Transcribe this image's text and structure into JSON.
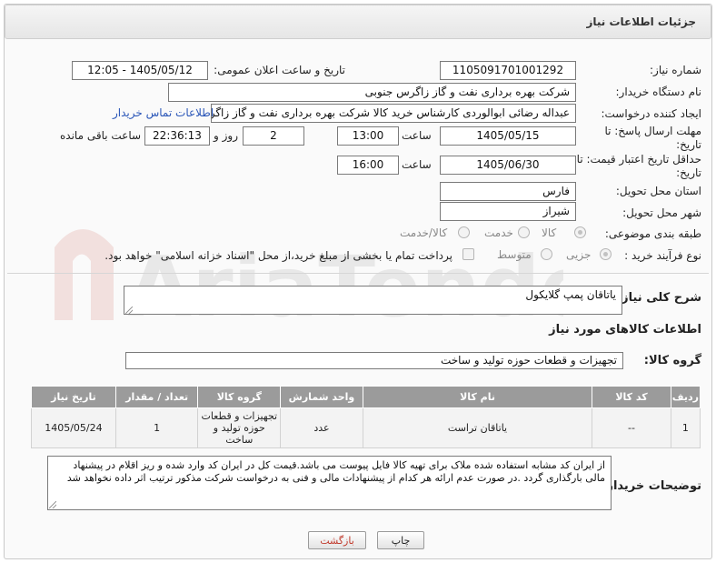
{
  "title": "جزئیات اطلاعات نیاز",
  "labels": {
    "need_number": "شماره نیاز:",
    "announce_date": "تاریخ و ساعت اعلان عمومی:",
    "buyer_org": "نام دستگاه خریدار:",
    "requester": "ایجاد کننده درخواست:",
    "reply_deadline": "مهلت ارسال پاسخ: تا تاریخ:",
    "price_validity": "حداقل تاریخ اعتبار قیمت: تا تاریخ:",
    "hour": "ساعت",
    "day_and": "روز و",
    "remaining": "ساعت باقی مانده",
    "province": "استان محل تحویل:",
    "city": "شهر محل تحویل:",
    "category": "طبقه بندی موضوعی:",
    "process_type": "نوع فرآیند خرید :",
    "general_desc": "شرح کلی نیاز:",
    "goods_info": "اطلاعات کالاهای مورد نیاز",
    "goods_group": "گروه کالا:",
    "buyer_notes": "توضیحات خریدار:"
  },
  "values": {
    "need_number": "1105091701001292",
    "announce_datetime": "1405/05/12 - 12:05",
    "buyer_org": "شرکت بهره برداری نفت و گاز زاگرس جنوبی",
    "requester": "عبداله رضائی ابوالوردی کارشناس خرید کالا شرکت بهره برداری نفت و گاز زاگرس",
    "contact_link": "اطلاعات تماس خریدار",
    "reply_date": "1405/05/15",
    "reply_time": "13:00",
    "remaining_days": "2",
    "remaining_time": "22:36:13",
    "validity_date": "1405/06/30",
    "validity_time": "16:00",
    "province": "فارس",
    "city": "شیراز",
    "general_desc": "یاتاقان پمپ گلایکول",
    "goods_group": "تجهیزات و قطعات حوزه تولید و ساخت",
    "buyer_notes": "از ایران کد مشابه استفاده شده ملاک برای تهیه کالا فایل پیوست می باشد.قیمت کل در ایران کد وارد شده و ریز اقلام در پیشنهاد مالی بارگذاری گردد .در صورت عدم ارائه هر کدام از پیشنهادات مالی و فنی به درخواست شرکت مذکور ترتیب اثر داده نخواهد شد"
  },
  "category_options": [
    "کالا",
    "خدمت",
    "کالا/خدمت"
  ],
  "category_selected": "کالا",
  "process_options": [
    "جزیی",
    "متوسط"
  ],
  "process_selected": "جزیی",
  "treasury_note": "پرداخت تمام یا بخشی از مبلغ خرید،از محل \"اسناد خزانه اسلامی\" خواهد بود.",
  "table": {
    "headers": [
      "ردیف",
      "کد کالا",
      "نام کالا",
      "واحد شمارش",
      "گروه کالا",
      "تعداد / مقدار",
      "تاریخ نیاز"
    ],
    "rows": [
      [
        "1",
        "--",
        "یاتاقان تراست",
        "عدد",
        "تجهیزات و قطعات حوزه تولید و ساخت",
        "1",
        "1405/05/24"
      ]
    ]
  },
  "buttons": {
    "print": "چاپ",
    "back": "بازگشت"
  },
  "watermark": "AriaTender.neT",
  "colors": {
    "header_bg": "#9b9b9b",
    "link": "#2a56b8",
    "back_btn_text": "#c0392b"
  }
}
